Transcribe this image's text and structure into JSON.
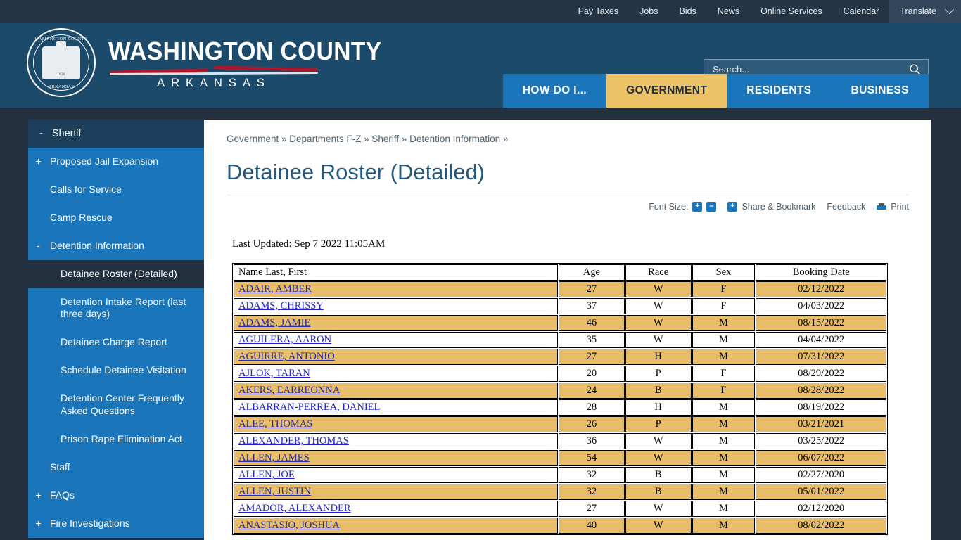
{
  "topbar": {
    "links": [
      "Pay Taxes",
      "Jobs",
      "Bids",
      "News",
      "Online Services",
      "Calendar"
    ],
    "translate": "Translate"
  },
  "brand": {
    "line1": "WASHINGTON COUNTY",
    "line2": "ARKANSAS",
    "seal_top": "WASHINGTON COUNTY",
    "seal_bottom": "ARKANSAS",
    "seal_year": "1828"
  },
  "search": {
    "placeholder": "Search...",
    "value": ""
  },
  "mainnav": [
    {
      "label": "HOW DO I...",
      "active": false
    },
    {
      "label": "GOVERNMENT",
      "active": true
    },
    {
      "label": "RESIDENTS",
      "active": false
    },
    {
      "label": "BUSINESS",
      "active": false
    }
  ],
  "sidebar": {
    "header": {
      "toggle": "-",
      "label": "Sheriff"
    },
    "items": [
      {
        "toggle": "+",
        "label": "Proposed Jail Expansion",
        "level": 1,
        "active": false
      },
      {
        "toggle": "",
        "label": "Calls for Service",
        "level": 1,
        "active": false
      },
      {
        "toggle": "",
        "label": "Camp Rescue",
        "level": 1,
        "active": false
      },
      {
        "toggle": "-",
        "label": "Detention Information",
        "level": 1,
        "active": false
      },
      {
        "toggle": "",
        "label": "Detainee Roster (Detailed)",
        "level": 2,
        "active": true
      },
      {
        "toggle": "",
        "label": "Detention Intake Report (last three days)",
        "level": 2,
        "active": false
      },
      {
        "toggle": "",
        "label": "Detainee Charge Report",
        "level": 2,
        "active": false
      },
      {
        "toggle": "",
        "label": "Schedule Detainee Visitation",
        "level": 2,
        "active": false
      },
      {
        "toggle": "",
        "label": "Detention Center Frequently Asked Questions",
        "level": 2,
        "active": false
      },
      {
        "toggle": "",
        "label": "Prison Rape Elimination Act",
        "level": 2,
        "active": false
      },
      {
        "toggle": "",
        "label": "Staff",
        "level": 1,
        "active": false
      },
      {
        "toggle": "+",
        "label": "FAQs",
        "level": 1,
        "active": false
      },
      {
        "toggle": "+",
        "label": "Fire Investigations",
        "level": 1,
        "active": false
      }
    ]
  },
  "main": {
    "breadcrumb": "Government » Departments F-Z » Sheriff » Detention Information »",
    "title": "Detainee Roster (Detailed)",
    "toolbar": {
      "font_size_label": "Font Size:",
      "increase": "+",
      "decrease": "–",
      "share_plus": "+",
      "share_label": "Share & Bookmark",
      "feedback_label": "Feedback",
      "print_label": "Print"
    },
    "last_updated": "Last Updated: Sep 7 2022 11:05AM",
    "table": {
      "columns": [
        "Name Last, First",
        "Age",
        "Race",
        "Sex",
        "Booking Date"
      ],
      "rows": [
        {
          "name": "ADAIR, AMBER ",
          "age": "27",
          "race": "W",
          "sex": "F",
          "booking": "02/12/2022",
          "hl": true
        },
        {
          "name": "ADAMS, CHRISSY ",
          "age": "37",
          "race": "W",
          "sex": "F",
          "booking": "04/03/2022",
          "hl": false
        },
        {
          "name": "ADAMS, JAMIE ",
          "age": "46",
          "race": "W",
          "sex": "M",
          "booking": "08/15/2022",
          "hl": true
        },
        {
          "name": "AGUILERA, AARON ",
          "age": "35",
          "race": "W",
          "sex": "M",
          "booking": "04/04/2022",
          "hl": false
        },
        {
          "name": "AGUIRRE, ANTONIO ",
          "age": "27",
          "race": "H",
          "sex": "M",
          "booking": "07/31/2022",
          "hl": true
        },
        {
          "name": "AJLOK, TARAN ",
          "age": "20",
          "race": "P",
          "sex": "F",
          "booking": "08/29/2022",
          "hl": false
        },
        {
          "name": "AKERS, EARREONNA ",
          "age": "24",
          "race": "B",
          "sex": "F",
          "booking": "08/28/2022",
          "hl": true
        },
        {
          "name": "ALBARRAN-PERREA, DANIEL ",
          "age": "28",
          "race": "H",
          "sex": "M",
          "booking": "08/19/2022",
          "hl": false
        },
        {
          "name": "ALEE, THOMAS ",
          "age": "26",
          "race": "P",
          "sex": "M",
          "booking": "03/21/2021",
          "hl": true
        },
        {
          "name": "ALEXANDER, THOMAS ",
          "age": "36",
          "race": "W",
          "sex": "M",
          "booking": "03/25/2022",
          "hl": false
        },
        {
          "name": "ALLEN, JAMES ",
          "age": "54",
          "race": "W",
          "sex": "M",
          "booking": "06/07/2022",
          "hl": true
        },
        {
          "name": "ALLEN, JOE ",
          "age": "32",
          "race": "B",
          "sex": "M",
          "booking": "02/27/2020",
          "hl": false
        },
        {
          "name": "ALLEN, JUSTIN ",
          "age": "32",
          "race": "B",
          "sex": "M",
          "booking": "05/01/2022",
          "hl": true
        },
        {
          "name": "AMADOR, ALEXANDER ",
          "age": "27",
          "race": "W",
          "sex": "M",
          "booking": "02/12/2020",
          "hl": false
        },
        {
          "name": "ANASTASIO, JOSHUA ",
          "age": "40",
          "race": "W",
          "sex": "M",
          "booking": "08/02/2022",
          "hl": true
        }
      ]
    }
  },
  "colors": {
    "topbar": "#263545",
    "header": "#1b4a6b",
    "nav_blue": "#1b75bb",
    "nav_active": "#eec368",
    "page_bg": "#22303f",
    "sidebar_head": "#1d3f5c",
    "row_highlight": "#e8bd69",
    "link": "#2222cc",
    "title": "#25597d"
  }
}
